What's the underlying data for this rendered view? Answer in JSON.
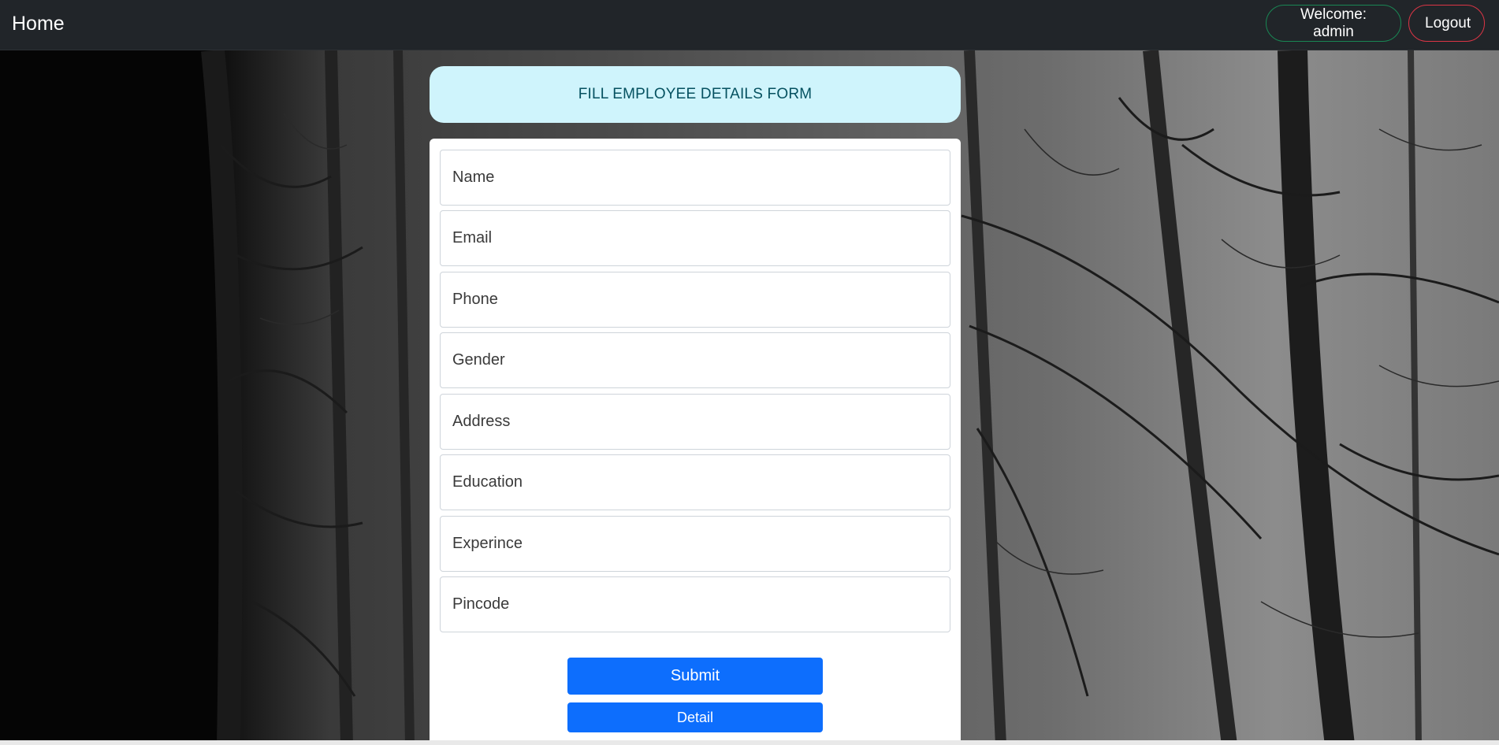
{
  "navbar": {
    "brand": "Home",
    "welcome_label": "Welcome: admin",
    "logout_label": "Logout"
  },
  "form": {
    "title": "FILL EMPLOYEE DETAILS FORM",
    "fields": [
      {
        "placeholder": "Name"
      },
      {
        "placeholder": "Email"
      },
      {
        "placeholder": "Phone"
      },
      {
        "placeholder": "Gender"
      },
      {
        "placeholder": "Address"
      },
      {
        "placeholder": "Education"
      },
      {
        "placeholder": "Experince"
      },
      {
        "placeholder": "Pincode"
      }
    ],
    "submit_label": "Submit",
    "detail_label": "Detail"
  },
  "colors": {
    "navbar_bg": "#212529",
    "welcome_border": "#198754",
    "logout_border": "#dc3545",
    "header_bg": "#cff4fc",
    "header_text": "#055160",
    "primary": "#0d6efd"
  }
}
